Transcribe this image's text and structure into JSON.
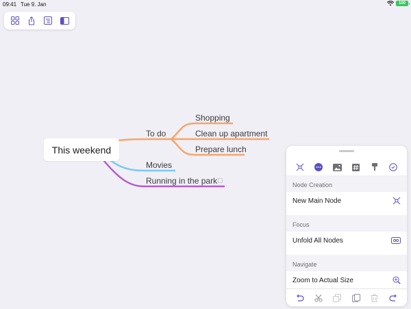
{
  "status": {
    "time": "09:41",
    "date": "Tue 9. Jan",
    "battery": "100"
  },
  "toolbar": {
    "icons": [
      "grid-icon",
      "share-icon",
      "outline-icon",
      "sidebar-icon"
    ]
  },
  "mindmap": {
    "root": "This weekend",
    "branches": [
      {
        "label": "To do",
        "color": "#f7a46b",
        "children": [
          "Shopping",
          "Clean up apartment",
          "Prepare lunch"
        ]
      },
      {
        "label": "Movies",
        "color": "#7ec8f5",
        "children": []
      },
      {
        "label": "Running in the park",
        "color": "#b45ad2",
        "children": []
      }
    ]
  },
  "panel": {
    "tab_icons": [
      "node-icon",
      "more-icon",
      "image-icon",
      "tag-icon",
      "format-icon",
      "check-icon"
    ],
    "sections": [
      {
        "header": "Node Creation",
        "row": "New Main Node",
        "row_icon": "new-main-node-icon"
      },
      {
        "header": "Focus",
        "row": "Unfold All Nodes",
        "row_icon": "unfold-icon"
      },
      {
        "header": "Navigate",
        "row": "Zoom to Actual Size",
        "row_icon": "zoom-icon"
      }
    ],
    "bottom_icons": [
      "undo-icon",
      "cut-icon",
      "copy-icon",
      "paste-icon",
      "delete-icon",
      "redo-icon"
    ]
  },
  "colors": {
    "accent": "#5b4fc4",
    "background": "#f0eff5"
  }
}
